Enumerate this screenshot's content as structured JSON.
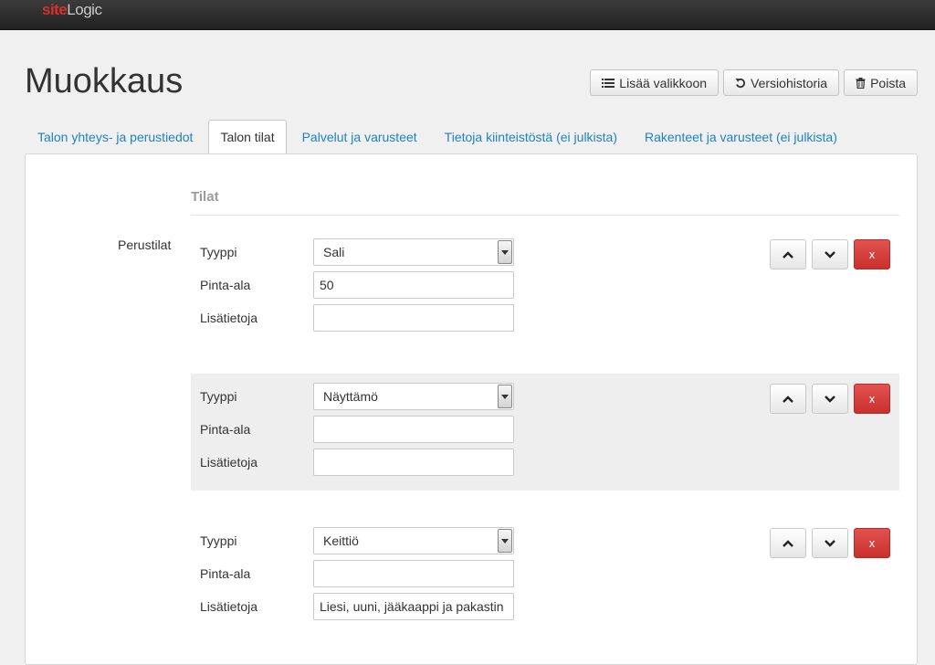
{
  "brand": {
    "logo_part1": "site",
    "logo_part2": "Logic"
  },
  "page": {
    "title": "Muokkaus"
  },
  "actions": {
    "add_menu": "Lisää valikkoon",
    "history": "Versiohistoria",
    "delete": "Poista"
  },
  "tabs": [
    {
      "label": "Talon yhteys- ja perustiedot",
      "active": false
    },
    {
      "label": "Talon tilat",
      "active": true
    },
    {
      "label": "Palvelut ja varusteet",
      "active": false
    },
    {
      "label": "Tietoja kiinteistöstä (ei julkista)",
      "active": false
    },
    {
      "label": "Rakenteet ja varusteet (ei julkista)",
      "active": false
    }
  ],
  "section": {
    "title": "Tilat",
    "group_label": "Perustilat",
    "labels": {
      "type": "Tyyppi",
      "area": "Pinta-ala",
      "info": "Lisätietoja"
    },
    "remove_label": "x",
    "items": [
      {
        "type": "Sali",
        "area": "50",
        "info": ""
      },
      {
        "type": "Näyttämö",
        "area": "",
        "info": ""
      },
      {
        "type": "Keittiö",
        "area": "",
        "info": "Liesi, uuni, jääkaappi ja pakastin"
      }
    ]
  }
}
